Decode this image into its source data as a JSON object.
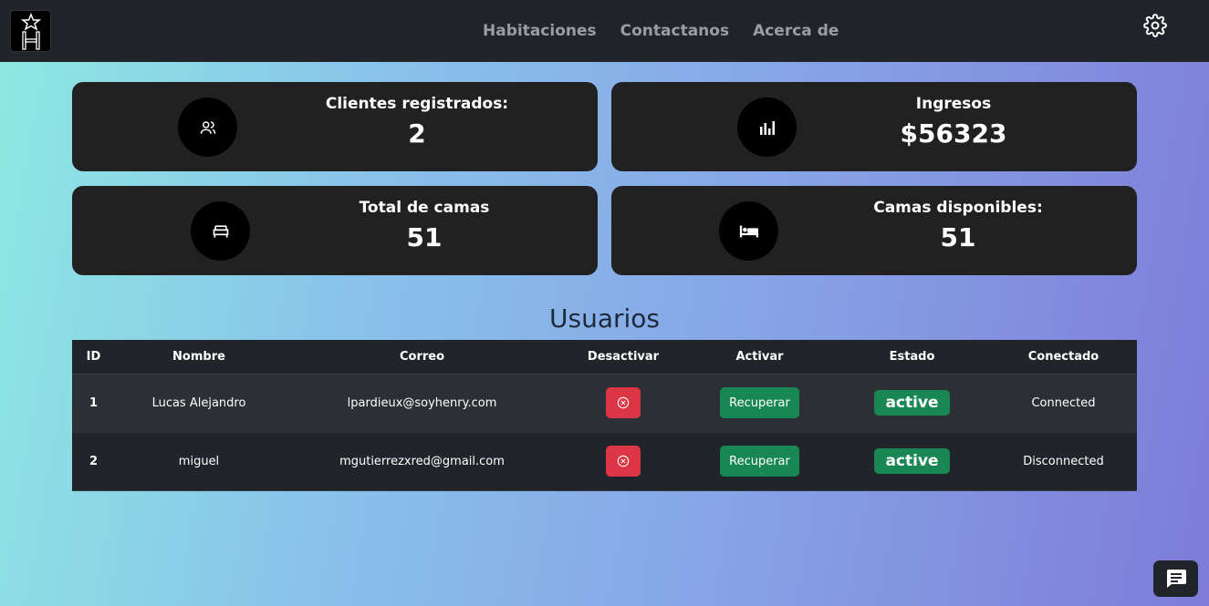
{
  "navbar": {
    "logo_icon": "hotel-star-logo",
    "links": [
      "Habitaciones",
      "Contactanos",
      "Acerca de"
    ],
    "settings_icon": "gear-icon"
  },
  "stats": [
    {
      "label": "Clientes registrados:",
      "value": "2",
      "icon": "users-icon"
    },
    {
      "label": "Ingresos",
      "value": "$56323",
      "icon": "bar-chart-icon"
    },
    {
      "label": "Total de camas",
      "value": "51",
      "icon": "bed-frame-icon"
    },
    {
      "label": "Camas disponibles:",
      "value": "51",
      "icon": "bed-icon"
    }
  ],
  "users": {
    "title": "Usuarios",
    "columns": [
      "ID",
      "Nombre",
      "Correo",
      "Desactivar",
      "Activar",
      "Estado",
      "Conectado"
    ],
    "rows": [
      {
        "id": "1",
        "name": "Lucas Alejandro",
        "email": "lpardieux@soyhenry.com",
        "activate_label": "Recuperar",
        "status": "active",
        "connected": "Connected"
      },
      {
        "id": "2",
        "name": "miguel",
        "email": "mgutierrezxred@gmail.com",
        "activate_label": "Recuperar",
        "status": "active",
        "connected": "Disconnected"
      }
    ]
  },
  "colors": {
    "navbar": "#212529",
    "card": "#212121",
    "danger": "#dc3545",
    "success": "#198754"
  },
  "chat_icon": "chat-icon"
}
